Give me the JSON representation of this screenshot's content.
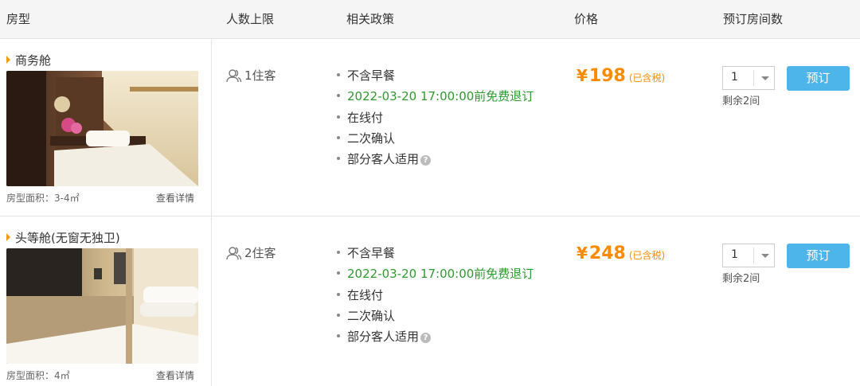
{
  "header": {
    "room_type": "房型",
    "max_guests": "人数上限",
    "policy": "相关政策",
    "price": "价格",
    "book_count": "预订房间数"
  },
  "rooms": [
    {
      "name": "商务舱",
      "area": "房型面积：3-4㎡",
      "detail": "查看详情",
      "guests": "1住客",
      "policies": [
        "不含早餐",
        "2022-03-20 17:00:00前免费退订",
        "在线付",
        "二次确认",
        "部分客人适用"
      ],
      "currency": "¥",
      "price": "198",
      "tax": "(已含税)",
      "quantity": "1",
      "remaining": "剩余2间",
      "book": "预订"
    },
    {
      "name": "头等舱(无窗无独卫)",
      "area": "房型面积：4㎡",
      "detail": "查看详情",
      "guests": "2住客",
      "policies": [
        "不含早餐",
        "2022-03-20 17:00:00前免费退订",
        "在线付",
        "二次确认",
        "部分客人适用"
      ],
      "currency": "¥",
      "price": "248",
      "tax": "(已含税)",
      "quantity": "1",
      "remaining": "剩余2间",
      "book": "预订"
    }
  ],
  "colors": {
    "price": "#ff8a00",
    "free_cancel": "#2e9a2e",
    "book_button": "#4eb5ea",
    "bullet_marker": "#f39c12"
  },
  "icons": {
    "guests": "user-group-icon",
    "help": "question-circle-icon",
    "dropdown": "chevron-down-icon"
  }
}
